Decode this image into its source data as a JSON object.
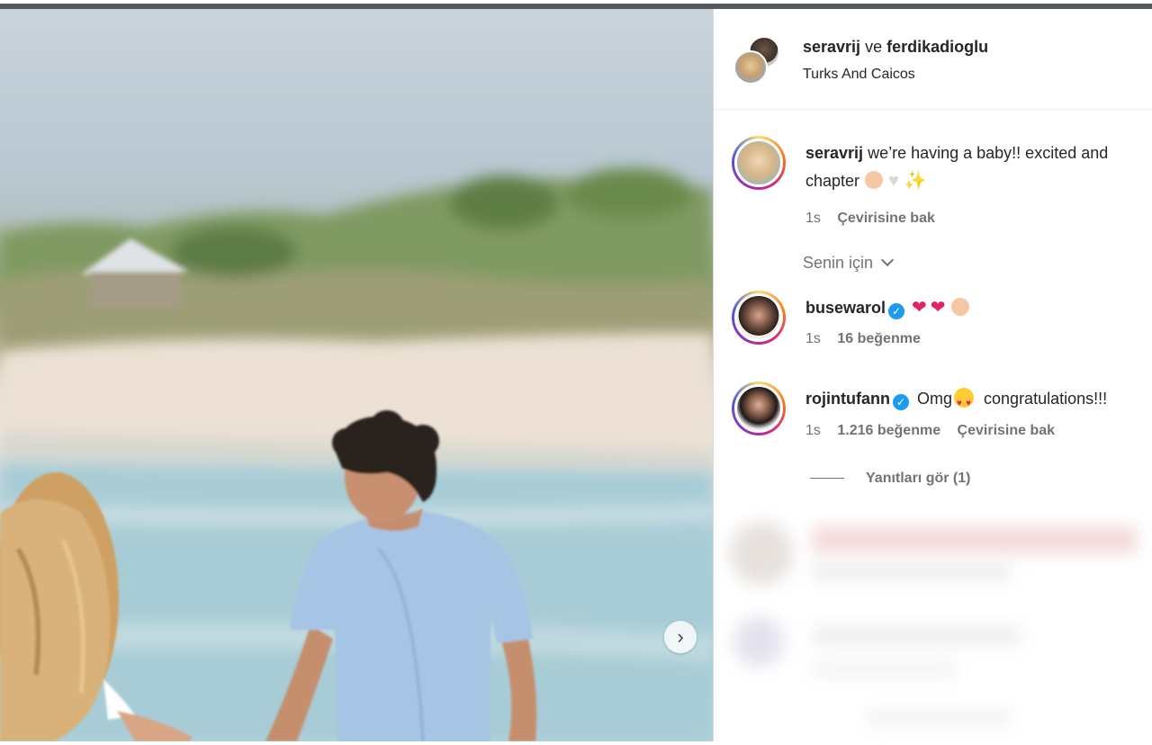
{
  "post": {
    "authors": {
      "user1": "seravrij",
      "connector": "ve",
      "user2": "ferdikadioglu"
    },
    "location": "Turks And Caicos",
    "caption": {
      "username": "seravrij",
      "text": "we’re having a baby!! excited and",
      "text_line2": "chapter",
      "time": "1s",
      "translate": "Çevirisine bak"
    }
  },
  "comments_filter": {
    "label": "Senin için",
    "icon": "chevron-down-icon"
  },
  "comments": [
    {
      "username": "busewarol",
      "verified": true,
      "text": "",
      "time": "1s",
      "likes": "16 beğenme"
    },
    {
      "username": "rojintufann",
      "verified": true,
      "text_before": "Omg",
      "text_after": "congratulations!!!",
      "time": "1s",
      "likes": "1.216 beğenme",
      "translate": "Çevirisine bak"
    }
  ],
  "view_replies": "Yanıtları gör (1)",
  "controls": {
    "next_icon": "›"
  },
  "colors": {
    "verified": "#1d9bf0",
    "heart": "#e0245e",
    "muted_text": "#737373"
  }
}
